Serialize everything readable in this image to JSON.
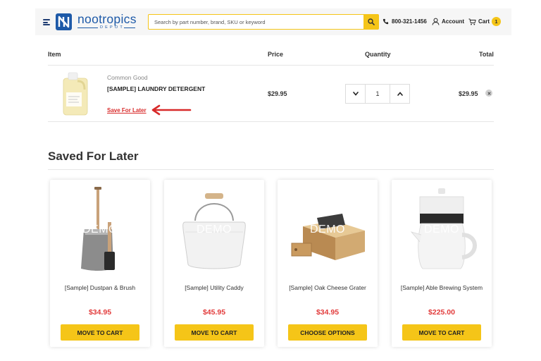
{
  "header": {
    "logo_text": "nootropics",
    "logo_sub": "DEPOT",
    "search_placeholder": "Search by part number, brand, SKU or keyword",
    "phone": "800-321-1456",
    "account_label": "Account",
    "cart_label": "Cart",
    "cart_count": "1",
    "accent_color": "#f5c518",
    "brand_color": "#1e5aa8"
  },
  "table": {
    "headers": [
      "Item",
      "Price",
      "Quantity",
      "Total"
    ],
    "item": {
      "brand": "Common Good",
      "name": "[SAMPLE] LAUNDRY DETERGENT",
      "save_link": "Save For Later",
      "price": "$29.95",
      "quantity": "1",
      "total": "$29.95"
    }
  },
  "saved": {
    "title": "Saved For Later",
    "watermark": "DEMO",
    "items": [
      {
        "name": "[Sample] Dustpan & Brush",
        "price": "$34.95",
        "button": "MOVE TO CART",
        "icon": "dustpan-brush-image"
      },
      {
        "name": "[Sample] Utility Caddy",
        "price": "$45.95",
        "button": "MOVE TO CART",
        "icon": "utility-caddy-image"
      },
      {
        "name": "[Sample] Oak Cheese Grater",
        "price": "$34.95",
        "button": "CHOOSE OPTIONS",
        "icon": "cheese-grater-image"
      },
      {
        "name": "[Sample] Able Brewing System",
        "price": "$225.00",
        "button": "MOVE TO CART",
        "icon": "brewing-system-image"
      }
    ]
  }
}
